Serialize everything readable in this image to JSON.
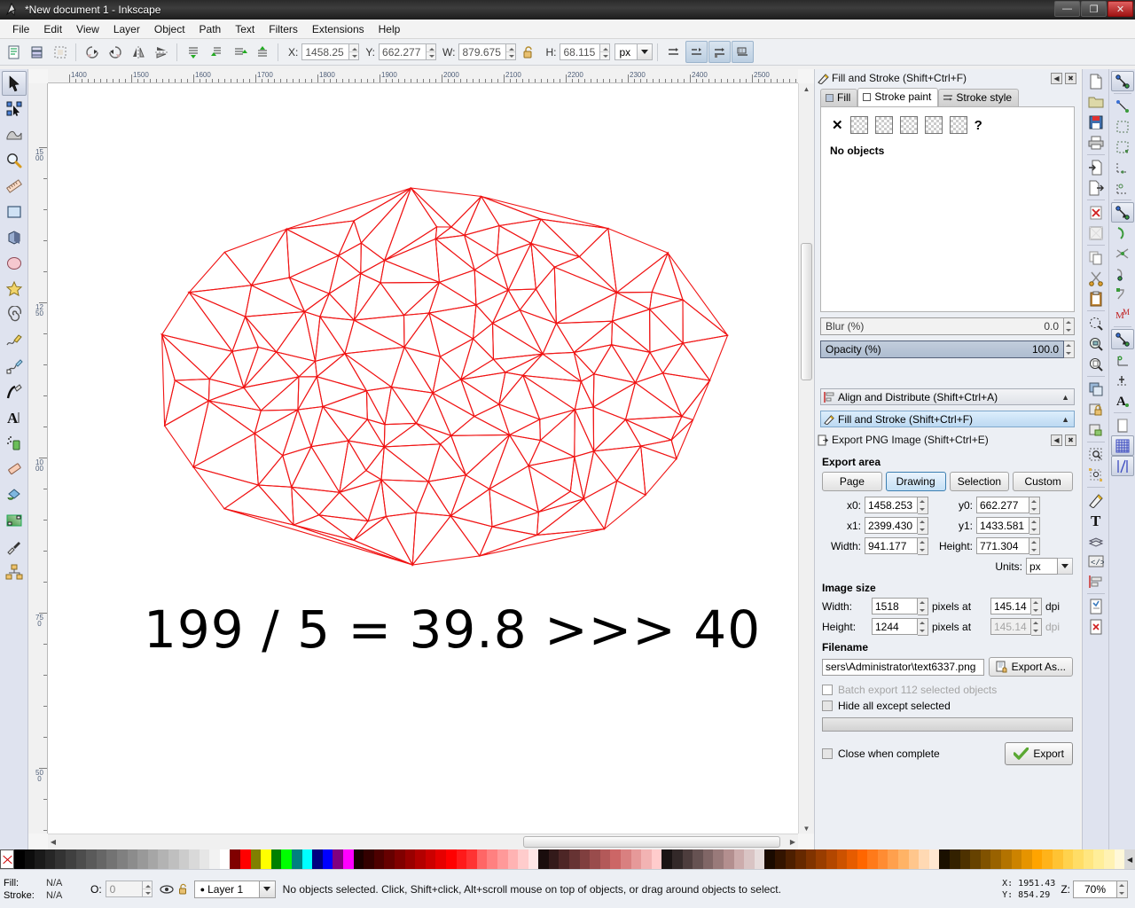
{
  "window": {
    "title": "*New document 1 - Inkscape",
    "app_icon": "inkscape-logo-icon",
    "buttons": [
      {
        "name": "minimize-button",
        "glyph": "—"
      },
      {
        "name": "maximize-button",
        "glyph": "❐"
      },
      {
        "name": "close-button",
        "glyph": "✕"
      }
    ]
  },
  "menubar": {
    "items": [
      {
        "label": "File",
        "mnemonic": "F"
      },
      {
        "label": "Edit",
        "mnemonic": "E"
      },
      {
        "label": "View",
        "mnemonic": "V"
      },
      {
        "label": "Layer",
        "mnemonic": "L"
      },
      {
        "label": "Object",
        "mnemonic": "O"
      },
      {
        "label": "Path",
        "mnemonic": "P"
      },
      {
        "label": "Text",
        "mnemonic": "T"
      },
      {
        "label": "Filters",
        "mnemonic": "s"
      },
      {
        "label": "Extensions",
        "mnemonic": "n"
      },
      {
        "label": "Help",
        "mnemonic": "H"
      }
    ]
  },
  "toolbar": {
    "x_label": "X:",
    "x_value": "1458.25",
    "y_label": "Y:",
    "y_value": "662.277",
    "w_label": "W:",
    "w_value": "879.675",
    "h_label": "H:",
    "h_value": "68.115",
    "lock_icon": "lock-open-icon",
    "units": "px",
    "icons": [
      "select-all-icon",
      "select-all-in-layers-icon",
      "deselect-icon",
      "rotate-90-ccw-icon",
      "rotate-90-cw-icon",
      "flip-horizontal-icon",
      "flip-vertical-icon",
      "raise-to-top-icon",
      "raise-icon",
      "lower-icon",
      "lower-to-bottom-icon",
      "transform-affect-stroke-icon",
      "transform-affect-corners-icon",
      "transform-affect-gradients-icon",
      "transform-affect-patterns-icon"
    ]
  },
  "toolbox": {
    "tools": [
      {
        "name": "selector-tool",
        "icon": "arrow-pointer-icon",
        "active": true
      },
      {
        "name": "node-tool",
        "icon": "node-editor-icon",
        "active": false
      },
      {
        "name": "tweak-tool",
        "icon": "tweak-icon",
        "active": false
      },
      {
        "name": "zoom-tool",
        "icon": "magnifier-icon",
        "active": false
      },
      {
        "name": "measure-tool",
        "icon": "ruler-icon",
        "active": false
      },
      {
        "name": "rectangle-tool",
        "icon": "rectangle-icon",
        "active": false
      },
      {
        "name": "box3d-tool",
        "icon": "cube-icon",
        "active": false
      },
      {
        "name": "ellipse-tool",
        "icon": "ellipse-icon",
        "active": false
      },
      {
        "name": "star-tool",
        "icon": "star-icon",
        "active": false
      },
      {
        "name": "spiral-tool",
        "icon": "spiral-icon",
        "active": false
      },
      {
        "name": "pencil-tool",
        "icon": "pencil-icon",
        "active": false
      },
      {
        "name": "bezier-tool",
        "icon": "pen-icon",
        "active": false
      },
      {
        "name": "calligraphy-tool",
        "icon": "calligraphy-icon",
        "active": false
      },
      {
        "name": "text-tool",
        "icon": "text-a-icon",
        "active": false
      },
      {
        "name": "spray-tool",
        "icon": "spray-can-icon",
        "active": false
      },
      {
        "name": "eraser-tool",
        "icon": "eraser-icon",
        "active": false
      },
      {
        "name": "paint-bucket-tool",
        "icon": "paint-bucket-icon",
        "active": false
      },
      {
        "name": "gradient-tool",
        "icon": "gradient-icon",
        "active": false
      },
      {
        "name": "dropper-tool",
        "icon": "eyedropper-icon",
        "active": false
      },
      {
        "name": "connector-tool",
        "icon": "connector-icon",
        "active": false
      }
    ]
  },
  "canvas": {
    "text_object": "199 / 5 = 39.8 >>> 40",
    "mesh_color": "#f01414",
    "mesh_name": "triangulated-mesh-drawing",
    "ruler_h_labels": [
      "1400",
      "1500",
      "1600",
      "1700",
      "1800",
      "1900",
      "2000",
      "2100",
      "2200",
      "2300",
      "2400",
      "2500"
    ],
    "ruler_v_labels": [
      "1500",
      "1250",
      "1000",
      "750",
      "500"
    ]
  },
  "fill_stroke_panel": {
    "title": "Fill and Stroke (Shift+Ctrl+F)",
    "title_icon": "fill-stroke-icon",
    "collapse_icon": "◀",
    "close_icon": "✖",
    "tabs": [
      {
        "label": "Fill",
        "icon": "fill-swatch-icon",
        "active": false
      },
      {
        "label": "Stroke paint",
        "icon": "stroke-paint-icon",
        "active": true
      },
      {
        "label": "Stroke style",
        "icon": "stroke-style-icon",
        "active": false
      }
    ],
    "paint_modes": [
      {
        "name": "no-paint-button",
        "glyph": "✕"
      },
      {
        "name": "flat-color-button",
        "glyph": ""
      },
      {
        "name": "linear-gradient-button",
        "glyph": ""
      },
      {
        "name": "radial-gradient-button",
        "glyph": ""
      },
      {
        "name": "pattern-button",
        "glyph": ""
      },
      {
        "name": "swatch-button",
        "glyph": ""
      },
      {
        "name": "unknown-paint-button",
        "glyph": "?"
      }
    ],
    "status": "No objects",
    "blur_label": "Blur (%)",
    "blur_value": "0.0",
    "opacity_label": "Opacity (%)",
    "opacity_value": "100.0"
  },
  "dialog_bars": [
    {
      "label": "Align and Distribute (Shift+Ctrl+A)",
      "icon": "align-distribute-icon",
      "selected": false,
      "caret": "▲"
    },
    {
      "label": "Fill and Stroke (Shift+Ctrl+F)",
      "icon": "fill-stroke-icon",
      "selected": true,
      "caret": "▲"
    }
  ],
  "export_panel": {
    "title": "Export PNG Image (Shift+Ctrl+E)",
    "title_icon": "export-png-icon",
    "collapse_icon": "◀",
    "close_icon": "✖",
    "export_area_label": "Export area",
    "area_buttons": [
      {
        "label": "Page",
        "active": false
      },
      {
        "label": "Drawing",
        "active": true
      },
      {
        "label": "Selection",
        "active": false
      },
      {
        "label": "Custom",
        "active": false
      }
    ],
    "x0_label": "x0:",
    "x0_value": "1458.253",
    "y0_label": "y0:",
    "y0_value": "662.277",
    "x1_label": "x1:",
    "x1_value": "2399.430",
    "y1_label": "y1:",
    "y1_value": "1433.581",
    "width_label": "Width:",
    "width_value": "941.177",
    "height_label": "Height:",
    "height_value": "771.304",
    "units_label": "Units:",
    "units_value": "px",
    "image_size_label": "Image size",
    "img_width_label": "Width:",
    "img_width_value": "1518",
    "img_height_label": "Height:",
    "img_height_value": "1244",
    "pixels_at_label": "pixels at",
    "dpi_w_value": "145.14",
    "dpi_h_value": "145.14",
    "dpi_label": "dpi",
    "filename_label": "Filename",
    "filename_value": "sers\\Administrator\\text6337.png",
    "export_as_label": "Export As...",
    "export_as_icon": "export-as-icon",
    "batch_label": "Batch export 112 selected objects",
    "hide_label": "Hide all except selected",
    "close_when_complete_label": "Close when complete",
    "export_button_label": "Export",
    "export_check_icon": "green-check-icon"
  },
  "right_commands": {
    "buttons": [
      {
        "name": "new-document-button",
        "icon": "new-doc-icon"
      },
      {
        "name": "open-document-button",
        "icon": "open-folder-icon"
      },
      {
        "name": "save-document-button",
        "icon": "floppy-save-icon"
      },
      {
        "name": "print-button",
        "icon": "printer-icon"
      },
      {
        "name": "import-button",
        "icon": "import-icon"
      },
      {
        "name": "export-button",
        "icon": "export-icon"
      },
      {
        "name": "undo-button",
        "icon": "undo-icon"
      },
      {
        "name": "redo-button",
        "icon": "redo-icon"
      },
      {
        "name": "copy-button",
        "icon": "copy-icon"
      },
      {
        "name": "cut-button",
        "icon": "scissors-icon"
      },
      {
        "name": "paste-button",
        "icon": "clipboard-icon"
      },
      {
        "name": "zoom-selection-button",
        "icon": "zoom-selection-icon"
      },
      {
        "name": "zoom-drawing-button",
        "icon": "zoom-drawing-icon"
      },
      {
        "name": "zoom-page-button",
        "icon": "zoom-page-icon"
      },
      {
        "name": "duplicate-button",
        "icon": "duplicate-icon"
      },
      {
        "name": "group-button",
        "icon": "group-lock-icon"
      },
      {
        "name": "ungroup-button",
        "icon": "ungroup-icon"
      },
      {
        "name": "object-properties-button",
        "icon": "object-props-icon"
      },
      {
        "name": "transform-dialog-button",
        "icon": "transform-icon"
      },
      {
        "name": "fill-stroke-dialog-button",
        "icon": "fill-stroke-icon"
      },
      {
        "name": "text-dialog-button",
        "icon": "text-t-icon"
      },
      {
        "name": "layers-dialog-button",
        "icon": "layers-icon"
      },
      {
        "name": "xml-editor-button",
        "icon": "xml-editor-icon"
      },
      {
        "name": "align-dialog-button",
        "icon": "align-icon"
      },
      {
        "name": "preferences-button",
        "icon": "preferences-icon"
      },
      {
        "name": "document-properties-button",
        "icon": "doc-props-icon"
      }
    ]
  },
  "snap_bar": {
    "buttons": [
      {
        "name": "enable-snapping-toggle",
        "icon": "snap-master-icon",
        "pressed": true
      },
      {
        "name": "snap-bounding-box-toggle",
        "icon": "snap-bbox-icon",
        "pressed": false
      },
      {
        "name": "snap-bbox-edge-toggle",
        "icon": "snap-bbox-edge-icon",
        "pressed": false
      },
      {
        "name": "snap-bbox-corner-toggle",
        "icon": "snap-bbox-corner-icon",
        "pressed": false
      },
      {
        "name": "snap-bbox-edge-midpoint-toggle",
        "icon": "snap-edge-mid-icon",
        "pressed": false
      },
      {
        "name": "snap-bbox-center-toggle",
        "icon": "snap-bbox-center-icon",
        "pressed": false
      },
      {
        "name": "snap-nodes-toggle",
        "icon": "snap-nodes-icon",
        "pressed": true
      },
      {
        "name": "snap-paths-toggle",
        "icon": "snap-path-icon",
        "pressed": false
      },
      {
        "name": "snap-path-intersections-toggle",
        "icon": "snap-intersection-icon",
        "pressed": false
      },
      {
        "name": "snap-to-cusp-nodes-toggle",
        "icon": "snap-cusp-icon",
        "pressed": false
      },
      {
        "name": "snap-smooth-nodes-toggle",
        "icon": "snap-smooth-icon",
        "pressed": false
      },
      {
        "name": "snap-midpoints-toggle",
        "icon": "snap-midpoint-icon",
        "pressed": false
      },
      {
        "name": "snap-others-toggle",
        "icon": "snap-others-icon",
        "pressed": true
      },
      {
        "name": "snap-object-centers-toggle",
        "icon": "snap-center-icon",
        "pressed": false
      },
      {
        "name": "snap-rotation-centers-toggle",
        "icon": "snap-rotation-icon",
        "pressed": false
      },
      {
        "name": "snap-text-baseline-toggle",
        "icon": "snap-text-baseline-icon",
        "pressed": false
      },
      {
        "name": "snap-page-border-toggle",
        "icon": "snap-page-border-icon",
        "pressed": false
      },
      {
        "name": "snap-grid-toggle",
        "icon": "snap-grid-icon",
        "pressed": true
      },
      {
        "name": "snap-guides-toggle",
        "icon": "snap-guide-icon",
        "pressed": true
      }
    ]
  },
  "statusbar": {
    "fill_label": "Fill:",
    "fill_value": "N/A",
    "stroke_label": "Stroke:",
    "stroke_value": "N/A",
    "opacity_label": "O:",
    "opacity_value": "0",
    "eye_icon": "eye-icon",
    "lock_icon": "lock-open-icon",
    "layer_name": "Layer 1",
    "message": "No objects selected. Click, Shift+click, Alt+scroll mouse on top of objects, or drag around objects to select.",
    "coord_x_label": "X:",
    "coord_x_value": "1951.43",
    "coord_y_label": "Y:",
    "coord_y_value": "854.29",
    "zoom_label": "Z:",
    "zoom_value": "70%"
  },
  "palette": {
    "name": "color-palette",
    "none_swatch": "no-color-swatch",
    "colors": [
      "#000000",
      "#0d0d0d",
      "#1a1a1a",
      "#262626",
      "#333333",
      "#404040",
      "#4d4d4d",
      "#5a5a5a",
      "#666666",
      "#737373",
      "#808080",
      "#8c8c8c",
      "#999999",
      "#a6a6a6",
      "#b3b3b3",
      "#bfbfbf",
      "#cccccc",
      "#d9d9d9",
      "#e6e6e6",
      "#f2f2f2",
      "#ffffff",
      "#800000",
      "#ff0000",
      "#808000",
      "#ffff00",
      "#008000",
      "#00ff00",
      "#008080",
      "#00ffff",
      "#000080",
      "#0000ff",
      "#800080",
      "#ff00ff",
      "#1a0000",
      "#330000",
      "#4d0000",
      "#660000",
      "#800000",
      "#990000",
      "#b30000",
      "#cc0000",
      "#e60000",
      "#ff0000",
      "#ff1a1a",
      "#ff3333",
      "#ff6666",
      "#ff8080",
      "#ff9999",
      "#ffb3b3",
      "#ffcccc",
      "#ffe6e6",
      "#1a0d0d",
      "#331a1a",
      "#4d2626",
      "#663333",
      "#803f3f",
      "#994c4c",
      "#b35959",
      "#cc6666",
      "#d98080",
      "#e69999",
      "#f2b3b3",
      "#ffcccc",
      "#1a1414",
      "#332929",
      "#4d3d3d",
      "#665252",
      "#806666",
      "#997a7a",
      "#b38f8f",
      "#ccacac",
      "#d9c4c4",
      "#e6dcdc",
      "#1a0a00",
      "#331400",
      "#4d1f00",
      "#662900",
      "#803300",
      "#993d00",
      "#b34700",
      "#cc5200",
      "#e65c00",
      "#ff6600",
      "#ff7a1a",
      "#ff8c33",
      "#ffa04d",
      "#ffb366",
      "#ffc68c",
      "#ffd9b3",
      "#ffe8d1",
      "#1a1000",
      "#332100",
      "#4d3100",
      "#664200",
      "#805200",
      "#996200",
      "#b37300",
      "#cc8300",
      "#e69400",
      "#ffa400",
      "#ffb31a",
      "#ffc333",
      "#ffd24d",
      "#ffdd66",
      "#ffe680",
      "#ffee99",
      "#fff2b3",
      "#fff8d9"
    ]
  }
}
